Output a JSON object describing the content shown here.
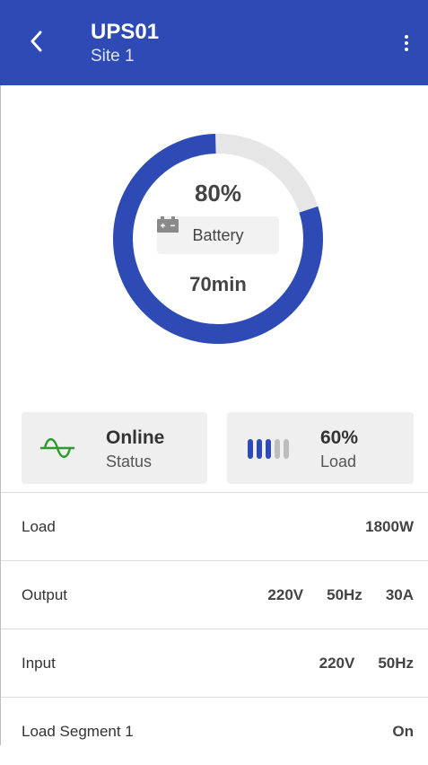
{
  "header": {
    "title": "UPS01",
    "subtitle": "Site 1",
    "back_icon": "chevron-left-icon",
    "menu_icon": "more-vertical-icon",
    "bar_color": "#2e4bb5"
  },
  "battery": {
    "percent_text": "80%",
    "percent_value": 0.8,
    "label": "Battery",
    "icon": "battery-icon",
    "runtime": "70min",
    "ring_color": "#2e4bb5",
    "track_color": "#e6e6e6"
  },
  "cards": {
    "status": {
      "value": "Online",
      "label": "Status",
      "icon": "sine-wave-icon",
      "icon_color": "#2e9a2e"
    },
    "load": {
      "value": "60%",
      "label": "Load",
      "icon": "load-bars-icon",
      "level": 0.6
    }
  },
  "rows": [
    {
      "name": "Load",
      "values": [
        "1800W"
      ]
    },
    {
      "name": "Output",
      "values": [
        "220V",
        "50Hz",
        "30A"
      ]
    },
    {
      "name": "Input",
      "values": [
        "220V",
        "50Hz"
      ]
    },
    {
      "name": "Load Segment 1",
      "values": [
        "On"
      ]
    }
  ]
}
